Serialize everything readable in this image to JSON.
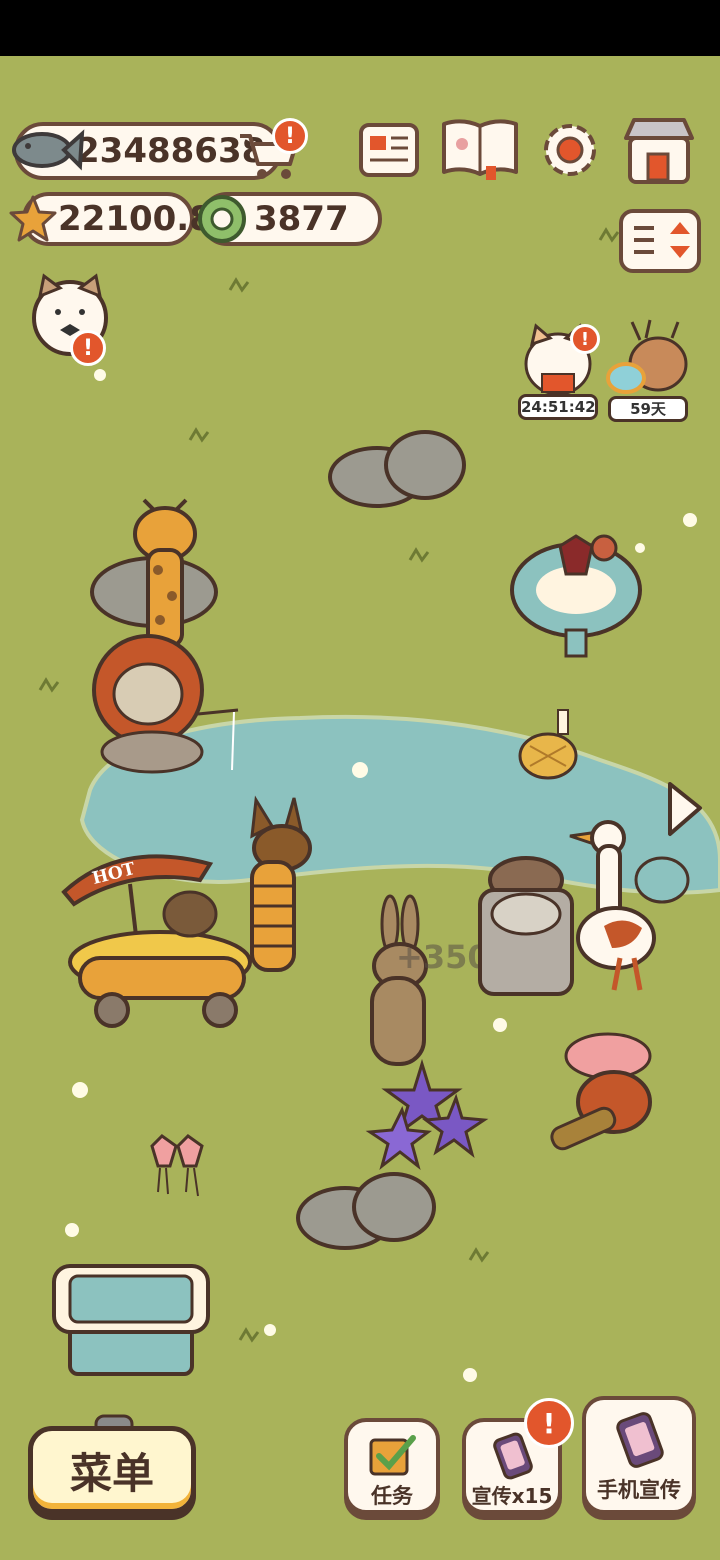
{
  "currencies": {
    "fish": "23488638",
    "star": "22100.8",
    "coin": "3877"
  },
  "badges": {
    "exclamation": "!"
  },
  "events": {
    "cat_timer": "24:51:42",
    "deer_days": "59天"
  },
  "world": {
    "floating_reward": "+3509"
  },
  "hot_dog_stand": {
    "sign": "HOT"
  },
  "bottom_bar": {
    "menu_label": "菜单",
    "tasks_label": "任务",
    "promote_label": "宣传x15",
    "phone_promote_label": "手机宣传"
  },
  "colors": {
    "grass": "#a9b35a",
    "pond": "#8cc2bf",
    "accent_orange": "#e2562c",
    "outline_brown": "#4a3328"
  }
}
